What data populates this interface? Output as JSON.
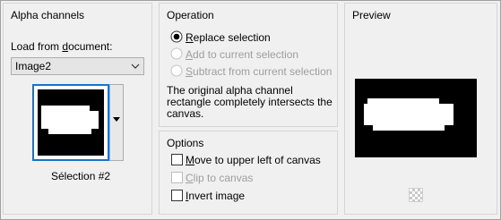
{
  "alpha_channels": {
    "title": "Alpha channels",
    "load_from_label_pre": "Load from ",
    "load_from_label_u": "d",
    "load_from_label_post": "ocument:",
    "document_value": "Image2",
    "channel_name": "Sélection #2"
  },
  "operation": {
    "title": "Operation",
    "replace": {
      "u": "R",
      "rest": "eplace selection",
      "selected": true
    },
    "add": {
      "u": "A",
      "rest": "dd to current selection",
      "enabled": false
    },
    "subtract": {
      "u": "S",
      "rest": "ubtract from current selection",
      "enabled": false
    },
    "description": [
      "The original alpha channel",
      "rectangle completely intersects the",
      "canvas."
    ]
  },
  "options": {
    "title": "Options",
    "move": {
      "u": "M",
      "rest": "ove to upper left of canvas",
      "checked": false
    },
    "clip": {
      "u": "C",
      "rest": "lip to canvas",
      "checked": false,
      "enabled": false
    },
    "invert": {
      "u": "I",
      "rest": "nvert image",
      "checked": false
    }
  },
  "preview": {
    "title": "Preview"
  },
  "colors": {
    "accent": "#1a73c9",
    "panel_bg": "#f0f0f0",
    "disabled_text": "#9e9e9e"
  }
}
